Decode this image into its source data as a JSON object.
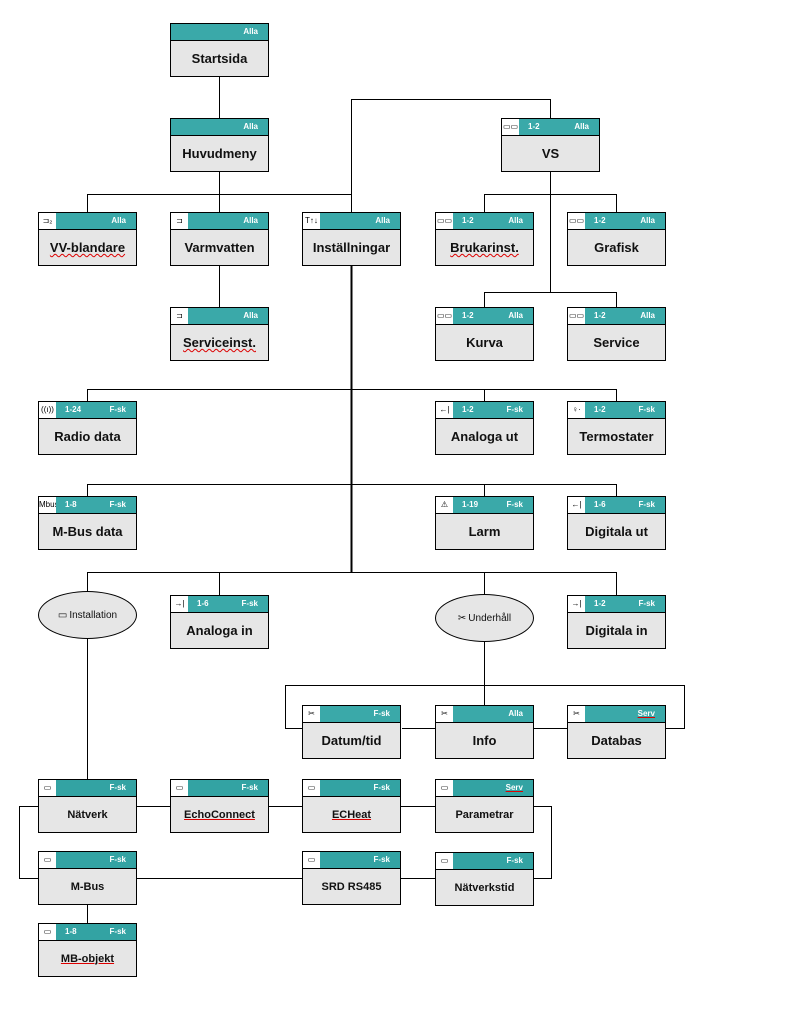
{
  "colors": {
    "header": "#3aa9a9",
    "header_dark": "#33a3a3",
    "box": "#e6e6e6"
  },
  "nodes": {
    "startsida": {
      "label": "Startsida",
      "level": "Alla"
    },
    "huvudmeny": {
      "label": "Huvudmeny",
      "level": "Alla"
    },
    "vs": {
      "label": "VS",
      "range": "1-2",
      "level": "Alla",
      "icon": "display-icon"
    },
    "vv_blandare": {
      "label": "VV-blandare",
      "level": "Alla",
      "icon": "tap-2-icon"
    },
    "varmvatten": {
      "label": "Varmvatten",
      "level": "Alla",
      "icon": "tap-icon"
    },
    "installningar": {
      "label": "Inställningar",
      "level": "Alla",
      "icon": "tools-icon"
    },
    "brukarinst": {
      "label": "Brukarinst.",
      "range": "1-2",
      "level": "Alla",
      "icon": "display-icon"
    },
    "grafisk": {
      "label": "Grafisk",
      "range": "1-2",
      "level": "Alla",
      "icon": "display-icon"
    },
    "serviceinst": {
      "label": "Serviceinst.",
      "level": "Alla",
      "icon": "tap-icon"
    },
    "kurva": {
      "label": "Kurva",
      "range": "1-2",
      "level": "Alla",
      "icon": "display-icon"
    },
    "service": {
      "label": "Service",
      "range": "1-2",
      "level": "Alla",
      "icon": "display-icon"
    },
    "radio_data": {
      "label": "Radio data",
      "range": "1-24",
      "level": "F-sk",
      "icon": "antenna-icon"
    },
    "analoga_ut": {
      "label": "Analoga ut",
      "range": "1-2",
      "level": "F-sk",
      "icon": "analog-out-icon"
    },
    "termostater": {
      "label": "Termostater",
      "range": "1-2",
      "level": "F-sk",
      "icon": "thermostat-icon"
    },
    "mbus_data": {
      "label": "M-Bus data",
      "range": "1-8",
      "level": "F-sk",
      "icon": "mbus-icon",
      "icon_text": "Mbus"
    },
    "larm": {
      "label": "Larm",
      "range": "1-19",
      "level": "F-sk",
      "icon": "alarm-icon"
    },
    "digitala_ut": {
      "label": "Digitala ut",
      "range": "1-6",
      "level": "F-sk",
      "icon": "digital-out-icon"
    },
    "installation": {
      "label": "Installation",
      "icon": "device-icon"
    },
    "analoga_in": {
      "label": "Analoga in",
      "range": "1-6",
      "level": "F-sk",
      "icon": "analog-in-icon"
    },
    "underhall": {
      "label": "Underhåll",
      "icon": "wrench-icon"
    },
    "digitala_in": {
      "label": "Digitala in",
      "range": "1-2",
      "level": "F-sk",
      "icon": "digital-in-icon"
    },
    "datum_tid": {
      "label": "Datum/tid",
      "level": "F-sk",
      "icon": "wrench-icon"
    },
    "info": {
      "label": "Info",
      "level": "Alla",
      "icon": "wrench-icon"
    },
    "databas": {
      "label": "Databas",
      "level": "Serv",
      "icon": "wrench-icon"
    },
    "natverk": {
      "label": "Nätverk",
      "level": "F-sk",
      "icon": "device-icon"
    },
    "echoconnect": {
      "label": "EchoConnect",
      "level": "F-sk",
      "icon": "device-icon"
    },
    "echeat": {
      "label": "ECHeat",
      "level": "F-sk",
      "icon": "device-icon"
    },
    "parametrar": {
      "label": "Parametrar",
      "level": "Serv",
      "icon": "device-icon"
    },
    "mbus": {
      "label": "M-Bus",
      "level": "F-sk",
      "icon": "device-icon"
    },
    "srd": {
      "label": "SRD RS485",
      "level": "F-sk",
      "icon": "device-icon"
    },
    "natverkstid": {
      "label": "Nätverkstid",
      "level": "F-sk",
      "icon": "device-icon"
    },
    "mb_objekt": {
      "label": "MB-objekt",
      "range": "1-8",
      "level": "F-sk",
      "icon": "device-icon"
    }
  }
}
